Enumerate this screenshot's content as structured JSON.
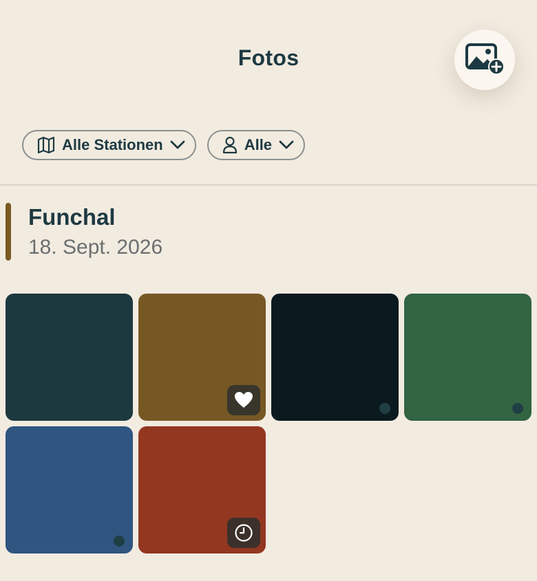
{
  "header": {
    "title": "Fotos",
    "add_photo_icon": "image-plus-icon"
  },
  "filters": [
    {
      "label": "Alle Stationen",
      "icon": "map-icon"
    },
    {
      "label": "Alle",
      "icon": "person-icon"
    }
  ],
  "section": {
    "title": "Funchal",
    "date": "18. Sept. 2026",
    "accent_color": "#7a5a22"
  },
  "photos": [
    {
      "color": "#1c3940",
      "indicator": "none"
    },
    {
      "color": "#765824",
      "indicator": "favorite-heart"
    },
    {
      "color": "#0b1a1f",
      "indicator": "dot"
    },
    {
      "color": "#326442",
      "indicator": "dot"
    },
    {
      "color": "#2f5580",
      "indicator": "dot"
    },
    {
      "color": "#933721",
      "indicator": "pending-clock"
    }
  ],
  "colors": {
    "background": "#f2ebe0",
    "text_primary": "#1d3a42",
    "text_secondary": "#6a6f6f"
  }
}
